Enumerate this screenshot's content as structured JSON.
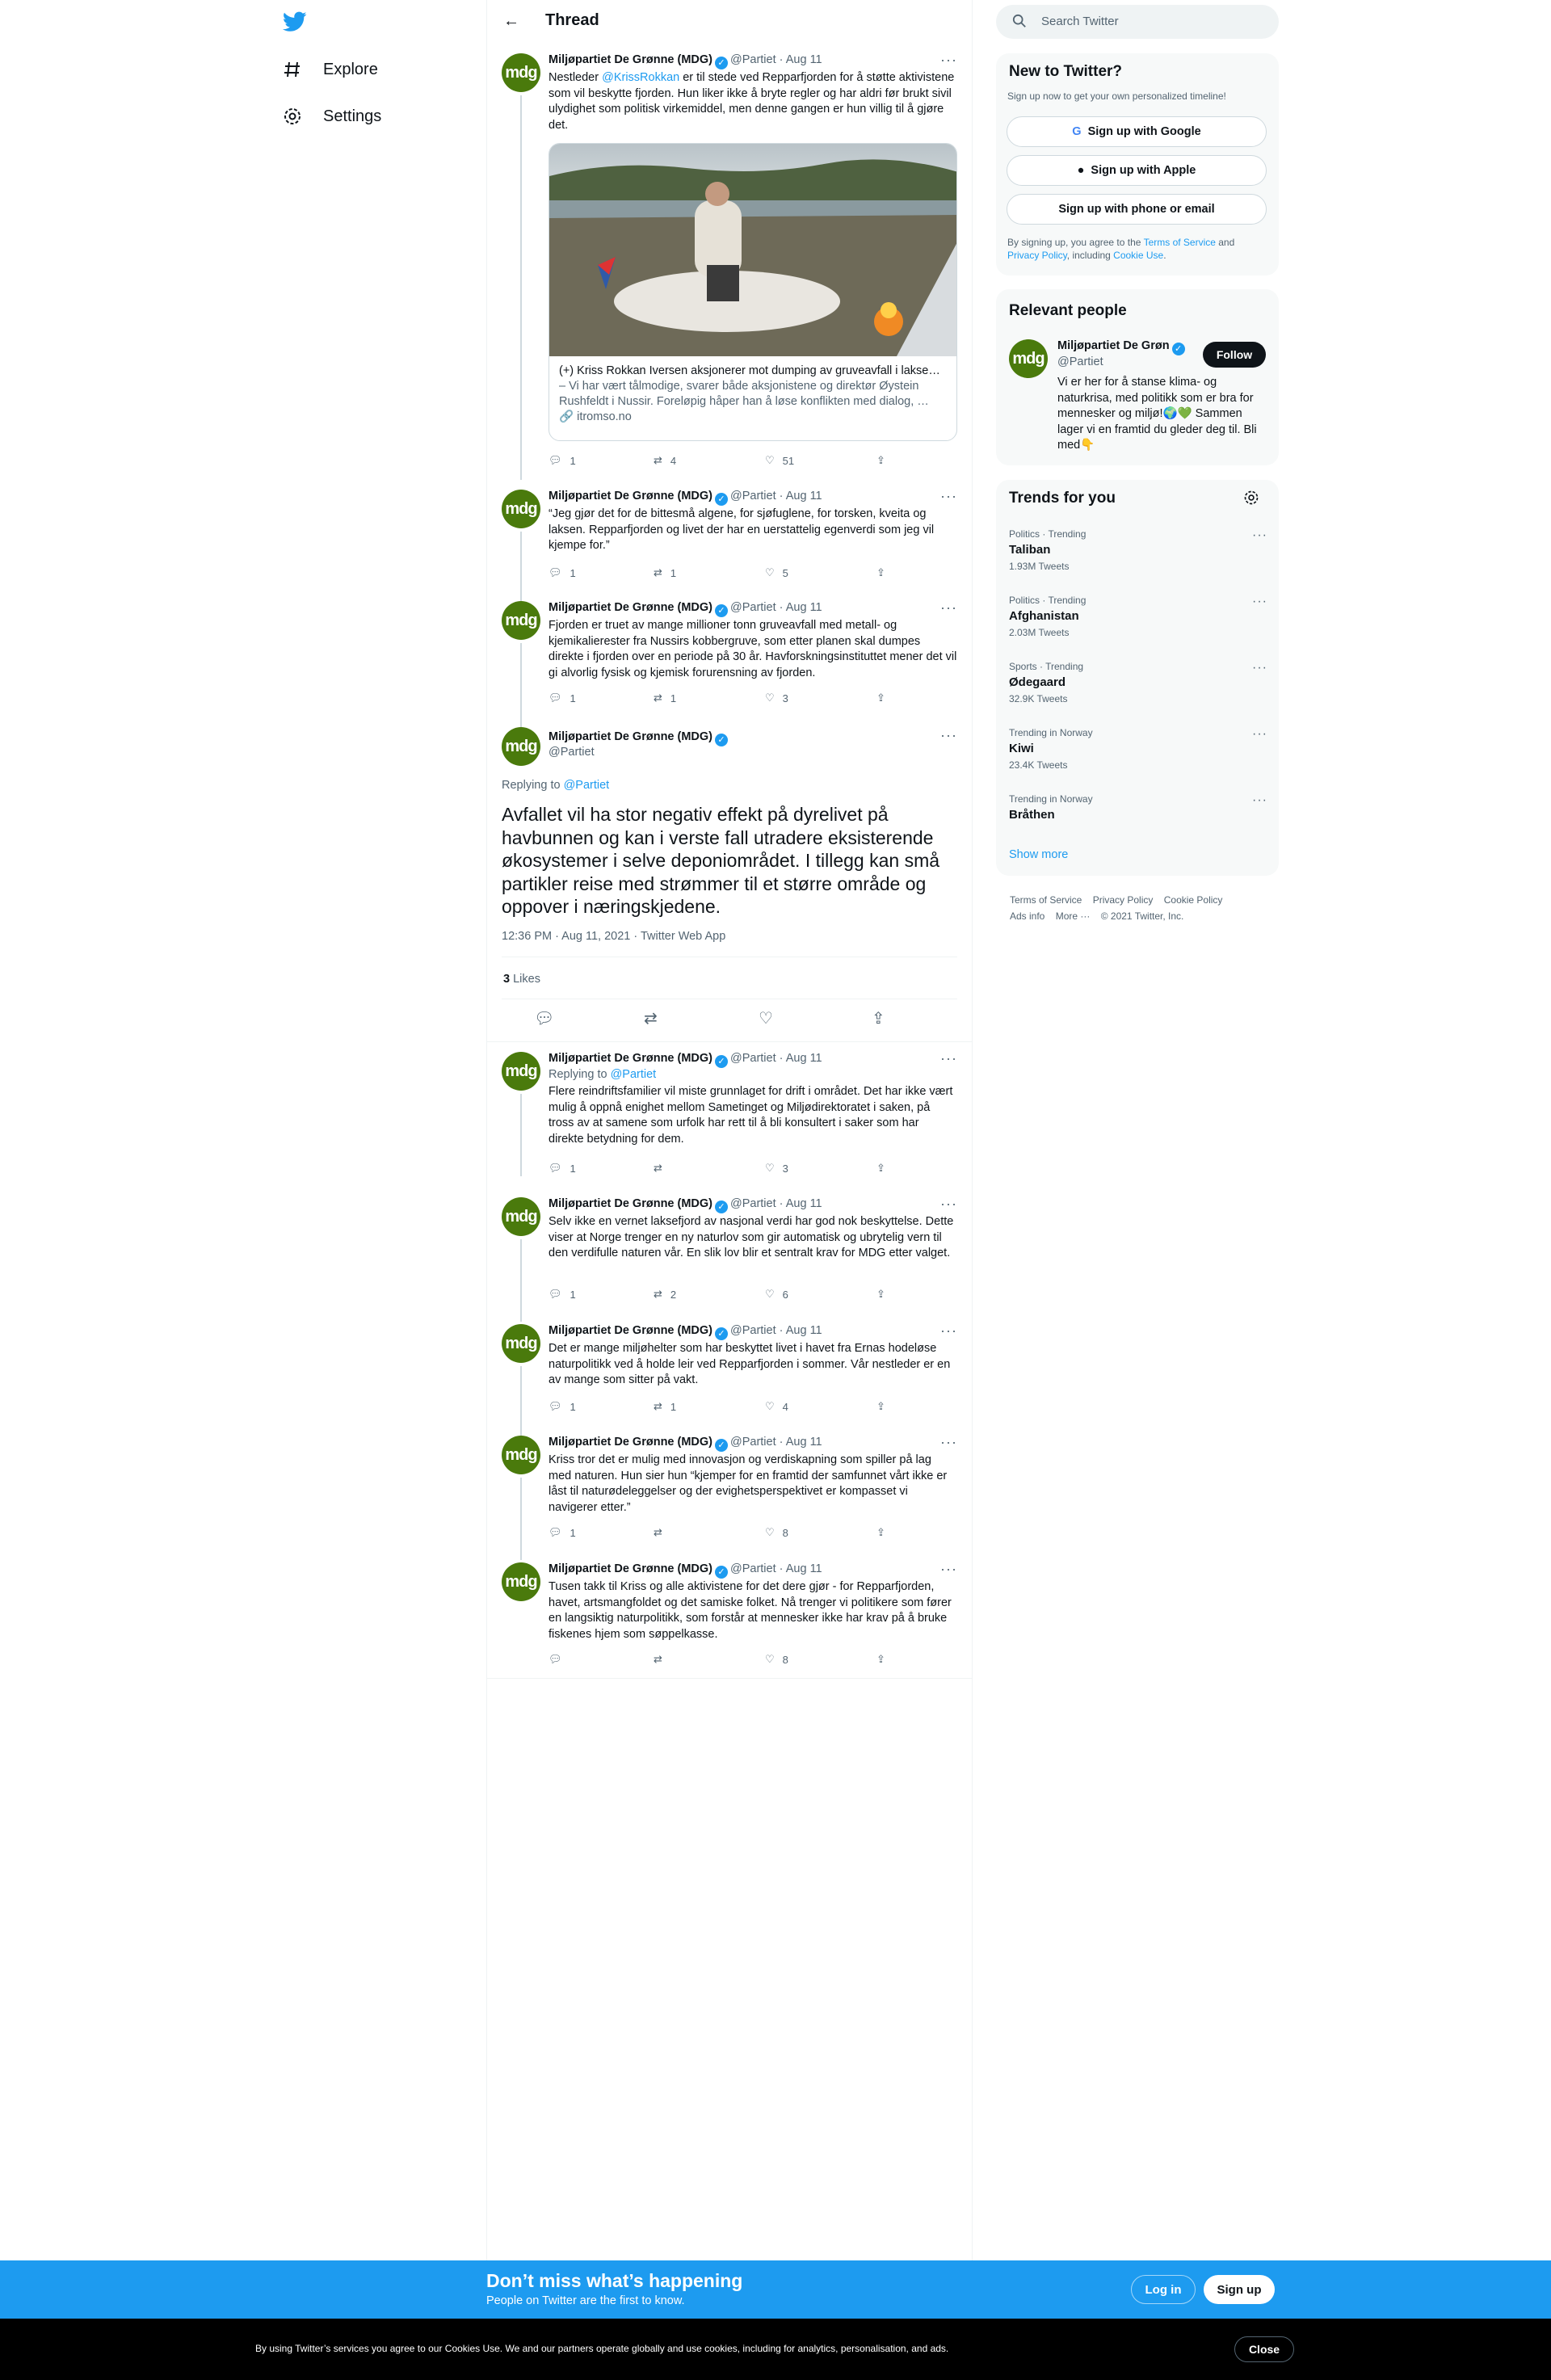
{
  "nav": {
    "explore": "Explore",
    "settings": "Settings"
  },
  "header": {
    "title": "Thread"
  },
  "search": {
    "placeholder": "Search Twitter"
  },
  "tweets": [
    {
      "name": "Miljøpartiet De Grønne (MDG)",
      "handle": "@Partiet",
      "date": "Aug 11",
      "text_pre": "Nestleder ",
      "mention": "@KrissRokkan",
      "text_post": " er til stede ved Repparfjorden for å støtte aktivistene som vil beskytte fjorden. Hun liker ikke å bryte regler og har aldri før brukt sivil ulydighet som politisk virkemiddel, men denne gangen er hun villig til å gjøre det.",
      "replies": "1",
      "retweets": "4",
      "likes": "51"
    },
    {
      "name": "Miljøpartiet De Grønne (MDG)",
      "handle": "@Partiet",
      "date": "Aug 11",
      "text": "“Jeg gjør det for de bittesmå algene, for sjøfuglene, for torsken, kveita og laksen. Repparfjorden og livet der har en uerstattelig egenverdi som jeg vil kjempe for.”",
      "replies": "1",
      "retweets": "1",
      "likes": "5"
    },
    {
      "name": "Miljøpartiet De Grønne (MDG)",
      "handle": "@Partiet",
      "date": "Aug 11",
      "text": "Fjorden er truet av mange millioner tonn gruveavfall med metall- og kjemikalierester fra Nussirs kobbergruve, som etter planen skal dumpes direkte i fjorden over en periode på 30 år. Havforskningsinstituttet mener det vil gi alvorlig fysisk og kjemisk forurensning av fjorden.",
      "replies": "1",
      "retweets": "1",
      "likes": "3"
    }
  ],
  "card": {
    "title": "(+) Kriss Rokkan Iversen aksjonerer mot dumping av gruveavfall i lakse…",
    "desc": "– Vi har vært tålmodige, svarer både aksjonistene og direktør Øystein Rushfeldt i Nussir. Foreløpig håper han å løse konflikten med dialog, …",
    "domain": "itromso.no"
  },
  "main": {
    "name": "Miljøpartiet De Grønne (MDG)",
    "handle": "@Partiet",
    "replying_label": "Replying to",
    "replying_to": "@Partiet",
    "text": "Avfallet vil ha stor negativ effekt på dyrelivet på havbunnen og kan i verste fall utradere eksisterende økosystemer i selve deponiområdet. I tillegg kan små partikler reise med strømmer til et større område og oppover i næringskjedene.",
    "meta": "12:36 PM · Aug 11, 2021 · Twitter Web App",
    "likes_count": "3",
    "likes_label": "Likes"
  },
  "replies": [
    {
      "name": "Miljøpartiet De Grønne (MDG)",
      "handle": "@Partiet",
      "date": "Aug 11",
      "replying_label": "Replying to",
      "replying_to": "@Partiet",
      "text": "Flere reindriftsfamilier vil miste grunnlaget for drift i området. Det har ikke vært mulig å oppnå enighet mellom Sametinget og Miljødirektoratet i saken, på tross av at samene som urfolk har rett til å bli konsultert i saker som har direkte betydning for dem.",
      "replies": "1",
      "retweets": "",
      "likes": "3"
    },
    {
      "name": "Miljøpartiet De Grønne (MDG)",
      "handle": "@Partiet",
      "date": "Aug 11",
      "text": "Selv ikke en vernet laksefjord av nasjonal verdi har god nok beskyttelse. Dette viser at Norge trenger en ny naturlov som gir automatisk og ubrytelig vern til den verdifulle naturen vår. En slik lov blir et sentralt krav for MDG etter valget.",
      "replies": "1",
      "retweets": "2",
      "likes": "6"
    },
    {
      "name": "Miljøpartiet De Grønne (MDG)",
      "handle": "@Partiet",
      "date": "Aug 11",
      "text": "Det er mange miljøhelter som har beskyttet livet i havet fra Ernas hodeløse naturpolitikk ved å holde leir ved Repparfjorden i sommer. Vår nestleder er en av mange som sitter på vakt.",
      "replies": "1",
      "retweets": "1",
      "likes": "4"
    },
    {
      "name": "Miljøpartiet De Grønne (MDG)",
      "handle": "@Partiet",
      "date": "Aug 11",
      "text": "Kriss tror det er mulig med innovasjon og verdiskapning som spiller på lag med naturen. Hun sier hun “kjemper for en framtid der samfunnet vårt ikke er låst til naturødeleggelser og der evighetsperspektivet er kompasset vi navigerer etter.”",
      "replies": "1",
      "retweets": "",
      "likes": "8"
    },
    {
      "name": "Miljøpartiet De Grønne (MDG)",
      "handle": "@Partiet",
      "date": "Aug 11",
      "text": "Tusen takk til Kriss og alle aktivistene for det dere gjør - for Repparfjorden, havet, artsmangfoldet og det samiske folket. Nå trenger vi politikere som fører en langsiktig naturpolitikk, som forstår at mennesker ikke har krav på å bruke fiskenes hjem som søppelkasse.",
      "replies": "",
      "retweets": "",
      "likes": "8"
    }
  ],
  "new_to_twitter": {
    "title": "New to Twitter?",
    "subtitle": "Sign up now to get your own personalized timeline!",
    "google": "Sign up with Google",
    "apple": "Sign up with Apple",
    "phone": "Sign up with phone or email",
    "legal_1": "By signing up, you agree to the ",
    "tos": "Terms of Service",
    "legal_2": " and ",
    "privacy": "Privacy Policy",
    "legal_3": ", including ",
    "cookie": "Cookie Use",
    "legal_4": "."
  },
  "relevant": {
    "title": "Relevant people",
    "name": "Miljøpartiet De Grøn",
    "handle": "@Partiet",
    "follow": "Follow",
    "bio": "Vi er her for å stanse klima- og naturkrisa, med politikk som er bra for mennesker og miljø!🌍💚 Sammen lager vi en framtid du gleder deg til. Bli med👇"
  },
  "trends": {
    "title": "Trends for you",
    "items": [
      {
        "context": "Politics · Trending",
        "name": "Taliban",
        "count": "1.93M Tweets"
      },
      {
        "context": "Politics · Trending",
        "name": "Afghanistan",
        "count": "2.03M Tweets"
      },
      {
        "context": "Sports · Trending",
        "name": "Ødegaard",
        "count": "32.9K Tweets"
      },
      {
        "context": "Trending in Norway",
        "name": "Kiwi",
        "count": "23.4K Tweets"
      },
      {
        "context": "Trending in Norway",
        "name": "Bråthen",
        "count": ""
      }
    ],
    "show_more": "Show more"
  },
  "footer": {
    "tos": "Terms of Service",
    "privacy": "Privacy Policy",
    "cookie": "Cookie Policy",
    "ads": "Ads info",
    "more": "More ···",
    "copy": "© 2021 Twitter, Inc."
  },
  "banner": {
    "title": "Don’t miss what’s happening",
    "subtitle": "People on Twitter are the first to know.",
    "login": "Log in",
    "signup": "Sign up"
  },
  "cookie_bar": {
    "text": "By using Twitter’s services you agree to our Cookies Use. We and our partners operate globally and use cookies, including for analytics, personalisation, and ads.",
    "close": "Close"
  },
  "colors": {
    "accent": "#1d9bf0",
    "avatar": "#4a7a0c"
  }
}
